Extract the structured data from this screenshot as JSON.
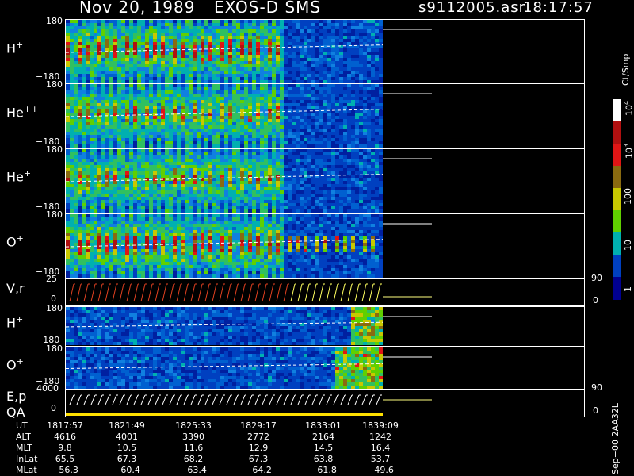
{
  "header": {
    "date": "Nov 20, 1989",
    "instrument": "EXOS-D SMS",
    "file": "s9112005.asr",
    "time": "18:17:57"
  },
  "panels": [
    {
      "label": "H",
      "sup": "+",
      "top": "180",
      "bottom": "−180"
    },
    {
      "label": "He",
      "sup": "++",
      "top": "180",
      "bottom": "−180"
    },
    {
      "label": "He",
      "sup": "+",
      "top": "180",
      "bottom": "−180"
    },
    {
      "label": "O",
      "sup": "+",
      "top": "180",
      "bottom": "−180"
    },
    {
      "label": "V,r",
      "sup": "",
      "top": "25",
      "bottom": "0",
      "right_top": "90",
      "right_bottom": "0"
    },
    {
      "label": "H",
      "sup": "+",
      "top": "180",
      "bottom": "−180"
    },
    {
      "label": "O",
      "sup": "+",
      "top": "180",
      "bottom": "−180"
    },
    {
      "label": "E,p",
      "sup": "",
      "top": "4000",
      "bottom": "0",
      "right_top": "90",
      "right_bottom": "0"
    }
  ],
  "qa_label": "QA",
  "colorbar": {
    "units": "Ct/Smp",
    "ticks": [
      {
        "base": "10",
        "exp": "4"
      },
      {
        "base": "10",
        "exp": "3"
      },
      {
        "base": "100",
        "exp": ""
      },
      {
        "base": "10",
        "exp": ""
      },
      {
        "base": "1",
        "exp": ""
      }
    ],
    "colors": [
      "#ffffff",
      "#b01010",
      "#e01515",
      "#8a6a10",
      "#c8c800",
      "#60d000",
      "#00b0b0",
      "#0040c0",
      "#000090"
    ]
  },
  "side_label": "Sep−00  2AA32L",
  "footer": {
    "row_labels": [
      "UT",
      "ALT",
      "MLT",
      "InLat",
      "MLat"
    ],
    "columns": [
      [
        "1817:57",
        "4616",
        "9.8",
        "65.5",
        "−56.3"
      ],
      [
        "1821:49",
        "4001",
        "10.5",
        "67.3",
        "−60.4"
      ],
      [
        "1825:33",
        "3390",
        "11.6",
        "68.2",
        "−63.4"
      ],
      [
        "1829:17",
        "2772",
        "12.9",
        "67.3",
        "−64.2"
      ],
      [
        "1833:01",
        "2164",
        "14.5",
        "63.8",
        "−61.8"
      ],
      [
        "1839:09",
        "1242",
        "16.4",
        "53.7",
        "−49.6"
      ]
    ]
  }
}
